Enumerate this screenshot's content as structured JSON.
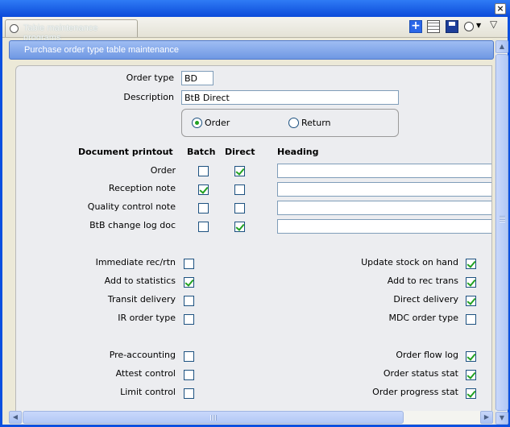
{
  "window": {
    "close_label": "×"
  },
  "tabbar": {
    "tab_title": "Table maintenance programs",
    "icons": [
      "add-icon",
      "grid-icon",
      "save-icon",
      "circle-icon",
      "dropdown-arrow-icon",
      "menu-arrow-icon"
    ]
  },
  "panel": {
    "title": "Purchase order type table maintenance"
  },
  "form": {
    "order_type_label": "Order type",
    "order_type_value": "BD",
    "description_label": "Description",
    "description_value": "BtB Direct",
    "radio": {
      "order_label": "Order",
      "return_label": "Return",
      "selected": "Order"
    },
    "printout": {
      "headers": {
        "doc": "Document printout",
        "batch": "Batch",
        "direct": "Direct",
        "heading": "Heading"
      },
      "rows": [
        {
          "label": "Order",
          "batch": false,
          "direct": true,
          "heading": ""
        },
        {
          "label": "Reception note",
          "batch": true,
          "direct": false,
          "heading": ""
        },
        {
          "label": "Quality control note",
          "batch": false,
          "direct": false,
          "heading": ""
        },
        {
          "label": "BtB change log doc",
          "batch": false,
          "direct": true,
          "heading": ""
        }
      ]
    },
    "options_left_1": [
      {
        "label": "Immediate rec/rtn",
        "checked": false
      },
      {
        "label": "Add to statistics",
        "checked": true
      },
      {
        "label": "Transit delivery",
        "checked": false
      },
      {
        "label": "IR order type",
        "checked": false
      }
    ],
    "options_right_1": [
      {
        "label": "Update stock on hand",
        "checked": true
      },
      {
        "label": "Add to rec trans",
        "checked": true
      },
      {
        "label": "Direct delivery",
        "checked": true
      },
      {
        "label": "MDC order type",
        "checked": false
      }
    ],
    "options_left_2": [
      {
        "label": "Pre-accounting",
        "checked": false
      },
      {
        "label": "Attest control",
        "checked": false
      },
      {
        "label": "Limit control",
        "checked": false
      }
    ],
    "options_right_2": [
      {
        "label": "Order flow log",
        "checked": true
      },
      {
        "label": "Order status stat",
        "checked": true
      },
      {
        "label": "Order progress stat",
        "checked": true
      }
    ]
  }
}
